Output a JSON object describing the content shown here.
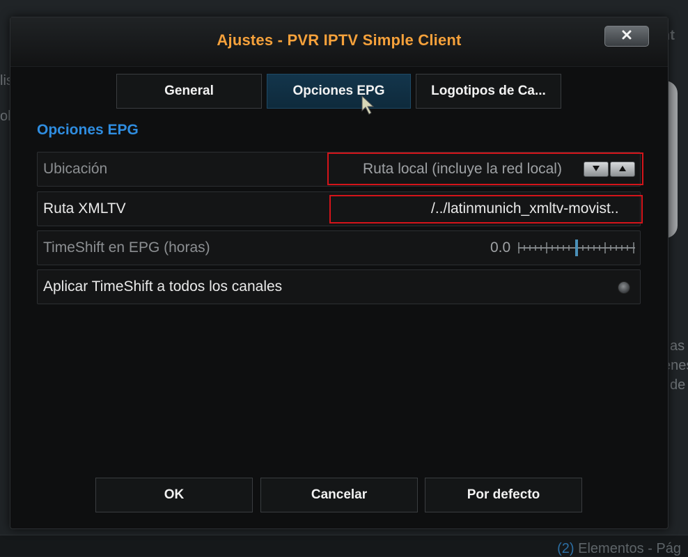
{
  "background": {
    "left_text": [
      "lis",
      "ola"
    ],
    "right_top_text": "nt",
    "right_text": [
      "as",
      "enes",
      "de"
    ],
    "status": {
      "count": "(2)",
      "text": "Elementos - Pág"
    }
  },
  "dialog": {
    "title": "Ajustes - PVR IPTV Simple Client",
    "close_icon": "close-icon",
    "tabs": [
      {
        "label": "General",
        "active": false
      },
      {
        "label": "Opciones EPG",
        "active": true
      },
      {
        "label": "Logotipos de Ca...",
        "active": false
      }
    ],
    "section_title": "Opciones EPG",
    "settings": [
      {
        "label": "Ubicación",
        "value": "Ruta local (incluye la red local)",
        "control": "spinner",
        "enabled": false
      },
      {
        "label": "Ruta XMLTV",
        "value": "/../latinmunich_xmltv-movist..",
        "control": "text",
        "enabled": true
      },
      {
        "label": "TimeShift en EPG (horas)",
        "value": "0.0",
        "control": "slider",
        "enabled": false
      },
      {
        "label": "Aplicar TimeShift a todos los canales",
        "value": "",
        "control": "radio",
        "enabled": true,
        "checked": false
      }
    ],
    "buttons": {
      "ok": "OK",
      "cancel": "Cancelar",
      "default": "Por defecto"
    }
  },
  "colors": {
    "title": "#f5a13b",
    "section_title": "#2f8de0",
    "highlight": "#d4141a",
    "active_tab": "#13354b"
  }
}
